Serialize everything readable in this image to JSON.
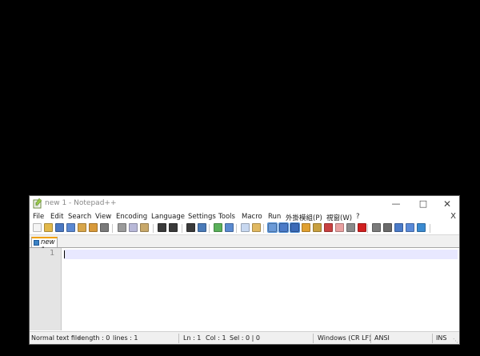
{
  "window": {
    "title": "new 1 - Notepad++"
  },
  "menu": {
    "items": [
      {
        "label": "File"
      },
      {
        "label": "Edit"
      },
      {
        "label": "Search"
      },
      {
        "label": "View"
      },
      {
        "label": "Encoding"
      },
      {
        "label": "Language"
      },
      {
        "label": "Settings"
      },
      {
        "label": "Tools"
      },
      {
        "label": "Macro"
      },
      {
        "label": "Run"
      },
      {
        "label": "外掛模組(P)"
      },
      {
        "label": "視窗(W)"
      },
      {
        "label": "?"
      }
    ],
    "close_label": "X"
  },
  "toolbar": {
    "buttons": [
      {
        "icon": "new-file-icon",
        "color": "#f4f4f4"
      },
      {
        "icon": "open-file-icon",
        "color": "#e2b84a"
      },
      {
        "icon": "save-icon",
        "color": "#4a78c2"
      },
      {
        "icon": "save-all-icon",
        "color": "#5a88d2"
      },
      {
        "icon": "close-icon",
        "color": "#d8a64a"
      },
      {
        "icon": "close-all-icon",
        "color": "#d89a3a"
      },
      {
        "icon": "print-icon",
        "color": "#7a7a7a"
      },
      {
        "icon": "cut-icon",
        "color": "#9a9a9a"
      },
      {
        "icon": "copy-icon",
        "color": "#b8b8d8"
      },
      {
        "icon": "paste-icon",
        "color": "#c8a86a"
      },
      {
        "icon": "undo-icon",
        "color": "#3a3a3a"
      },
      {
        "icon": "redo-icon",
        "color": "#3a3a3a"
      },
      {
        "icon": "find-icon",
        "color": "#3a3a3a"
      },
      {
        "icon": "replace-icon",
        "color": "#4a7ab8"
      },
      {
        "icon": "zoom-in-icon",
        "color": "#5ab05a"
      },
      {
        "icon": "zoom-out-icon",
        "color": "#5a8ad0"
      },
      {
        "icon": "sync-vertical-icon",
        "color": "#c8d8f0"
      },
      {
        "icon": "sync-horizontal-icon",
        "color": "#e0b860"
      },
      {
        "icon": "word-wrap-icon",
        "color": "#6a9ad8"
      },
      {
        "icon": "show-all-characters-icon",
        "color": "#4a7ac8"
      },
      {
        "icon": "indent-guide-icon",
        "color": "#3a6ab8"
      },
      {
        "icon": "define-language-icon",
        "color": "#e0a030"
      },
      {
        "icon": "document-map-icon",
        "color": "#c8a040"
      },
      {
        "icon": "function-list-icon",
        "color": "#c84040"
      },
      {
        "icon": "folder-as-workspace-icon",
        "color": "#e8a0a0"
      },
      {
        "icon": "monitoring-icon",
        "color": "#8a8a8a"
      },
      {
        "icon": "record-macro-icon",
        "color": "#d02020"
      },
      {
        "icon": "stop-recording-icon",
        "color": "#7a7a7a"
      },
      {
        "icon": "playback-macro-icon",
        "color": "#6a6a6a"
      },
      {
        "icon": "run-macro-multiple-icon",
        "color": "#4a7ac8"
      },
      {
        "icon": "save-macro-icon",
        "color": "#5a8ad8"
      },
      {
        "icon": "html-tag-icon",
        "color": "#3a8ad0"
      }
    ]
  },
  "tabs": [
    {
      "label": "new 1",
      "active": true
    }
  ],
  "editor": {
    "line_numbers": [
      "1"
    ]
  },
  "status": {
    "file_type": "Normal text file",
    "length": "length : 0",
    "lines": "lines : 1",
    "ln": "Ln : 1",
    "col": "Col : 1",
    "sel": "Sel : 0 | 0",
    "eol": "Windows (CR LF)",
    "encoding": "ANSI",
    "mode": "INS"
  }
}
